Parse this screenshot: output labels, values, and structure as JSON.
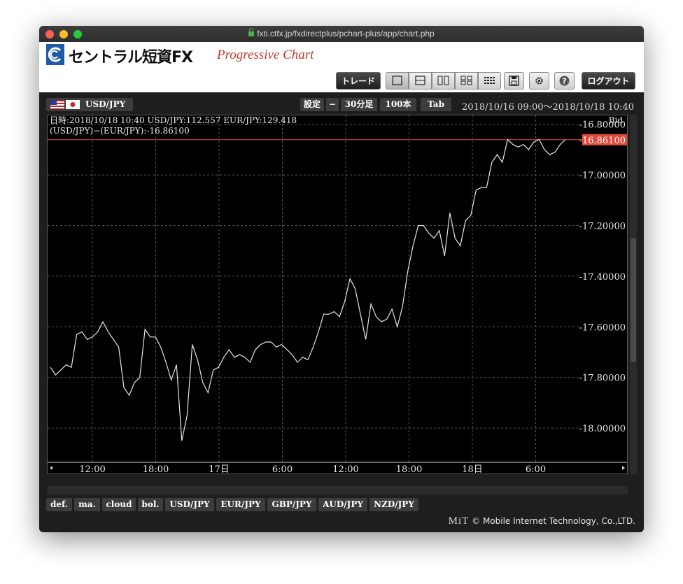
{
  "browser": {
    "url": "fxti.ctfx.jp/fxdirectplus/pchart-plus/app/chart.php"
  },
  "header": {
    "brand": "セントラル短資FX",
    "product": "Progressive Chart",
    "trade_label": "トレード",
    "logout_label": "ログアウト",
    "help_label": "?"
  },
  "toolbar": {
    "symbol": "USD/JPY",
    "settings_label": "設定",
    "minus_label": "−",
    "timeframe": "30分足",
    "count": "100本",
    "tab_label": "Tab",
    "range_text": "2018/10/16 09:00〜2018/10/18 10:40"
  },
  "hud": {
    "line1": "日時:2018/10/18 10:40  USD/JPY:112.557  EUR/JPY:129.418",
    "line2": "(USD/JPY)−(EUR/JPY):-16.86100",
    "side": "Bid"
  },
  "bottom_tabs": [
    "def.",
    "ma.",
    "cloud",
    "bol.",
    "USD/JPY",
    "EUR/JPY",
    "GBP/JPY",
    "AUD/JPY",
    "NZD/JPY"
  ],
  "footer": {
    "logo": "MiT",
    "copyright": "© Mobile Internet Technology, Co.,LTD."
  },
  "colors": {
    "price_line": "#e04a3a",
    "series": "#e6e6e6",
    "grid": "#555555"
  },
  "chart_data": {
    "type": "line",
    "x_labels": [
      "12:00",
      "18:00",
      "17日",
      "6:00",
      "12:00",
      "18:00",
      "18日",
      "6:00"
    ],
    "y_ticks": [
      -16.8,
      -17.0,
      -17.2,
      -17.4,
      -17.6,
      -17.8,
      -18.0
    ],
    "ylim": [
      -18.135,
      -16.765
    ],
    "current_value": -16.861,
    "current_label": "-16.86100",
    "series": [
      {
        "values": [
          -17.76,
          -17.79,
          -17.77,
          -17.75,
          -17.76,
          -17.63,
          -17.62,
          -17.65,
          -17.64,
          -17.62,
          -17.58,
          -17.62,
          -17.65,
          -17.68,
          -17.84,
          -17.87,
          -17.82,
          -17.8,
          -17.61,
          -17.64,
          -17.64,
          -17.68,
          -17.74,
          -17.81,
          -17.75,
          -18.05,
          -17.95,
          -17.67,
          -17.73,
          -17.82,
          -17.86,
          -17.77,
          -17.76,
          -17.72,
          -17.69,
          -17.72,
          -17.71,
          -17.72,
          -17.74,
          -17.69,
          -17.67,
          -17.66,
          -17.66,
          -17.68,
          -17.67,
          -17.69,
          -17.71,
          -17.74,
          -17.72,
          -17.73,
          -17.68,
          -17.62,
          -17.55,
          -17.55,
          -17.54,
          -17.56,
          -17.5,
          -17.41,
          -17.45,
          -17.55,
          -17.65,
          -17.51,
          -17.56,
          -17.58,
          -17.57,
          -17.53,
          -17.6,
          -17.52,
          -17.38,
          -17.28,
          -17.2,
          -17.2,
          -17.23,
          -17.25,
          -17.22,
          -17.32,
          -17.15,
          -17.25,
          -17.28,
          -17.18,
          -17.16,
          -17.06,
          -17.05,
          -17.05,
          -16.95,
          -16.92,
          -16.95,
          -16.86,
          -16.88,
          -16.89,
          -16.88,
          -16.9,
          -16.87,
          -16.86,
          -16.9,
          -16.92,
          -16.91,
          -16.88,
          -16.86
        ]
      }
    ]
  }
}
